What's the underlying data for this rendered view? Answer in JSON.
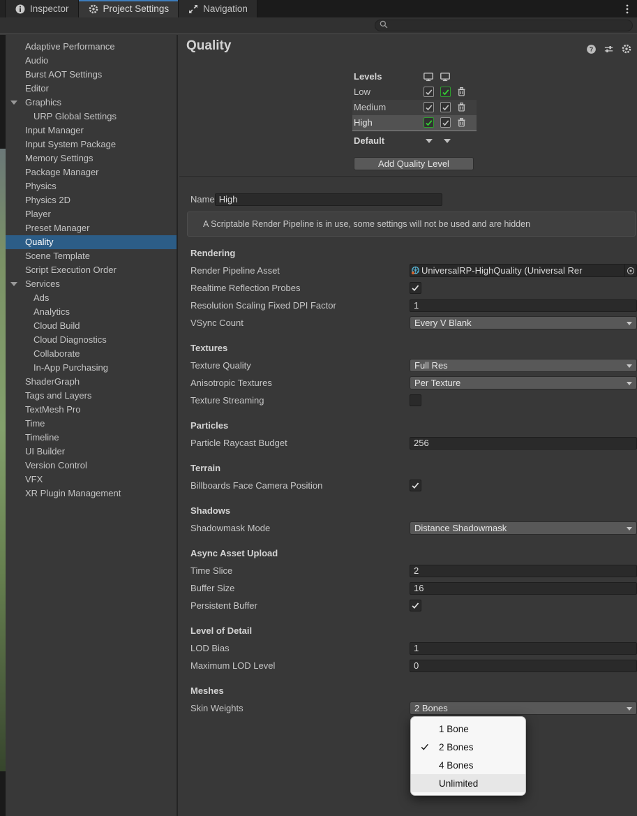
{
  "window": {
    "tabs": [
      {
        "label": "Inspector",
        "icon": "info-icon",
        "active": false
      },
      {
        "label": "Project Settings",
        "icon": "gear-icon",
        "active": true
      },
      {
        "label": "Navigation",
        "icon": "navigation-icon",
        "active": false
      }
    ],
    "search": {
      "value": ""
    }
  },
  "sidebar": {
    "items": [
      {
        "label": "Adaptive Performance",
        "indent": 0
      },
      {
        "label": "Audio",
        "indent": 0
      },
      {
        "label": "Burst AOT Settings",
        "indent": 0
      },
      {
        "label": "Editor",
        "indent": 0
      },
      {
        "label": "Graphics",
        "indent": 0,
        "expanded": true
      },
      {
        "label": "URP Global Settings",
        "indent": 1
      },
      {
        "label": "Input Manager",
        "indent": 0
      },
      {
        "label": "Input System Package",
        "indent": 0
      },
      {
        "label": "Memory Settings",
        "indent": 0
      },
      {
        "label": "Package Manager",
        "indent": 0
      },
      {
        "label": "Physics",
        "indent": 0
      },
      {
        "label": "Physics 2D",
        "indent": 0
      },
      {
        "label": "Player",
        "indent": 0
      },
      {
        "label": "Preset Manager",
        "indent": 0
      },
      {
        "label": "Quality",
        "indent": 0,
        "selected": true
      },
      {
        "label": "Scene Template",
        "indent": 0
      },
      {
        "label": "Script Execution Order",
        "indent": 0
      },
      {
        "label": "Services",
        "indent": 0,
        "expanded": true
      },
      {
        "label": "Ads",
        "indent": 1
      },
      {
        "label": "Analytics",
        "indent": 1
      },
      {
        "label": "Cloud Build",
        "indent": 1
      },
      {
        "label": "Cloud Diagnostics",
        "indent": 1
      },
      {
        "label": "Collaborate",
        "indent": 1
      },
      {
        "label": "In-App Purchasing",
        "indent": 1
      },
      {
        "label": "ShaderGraph",
        "indent": 0
      },
      {
        "label": "Tags and Layers",
        "indent": 0
      },
      {
        "label": "TextMesh Pro",
        "indent": 0
      },
      {
        "label": "Time",
        "indent": 0
      },
      {
        "label": "Timeline",
        "indent": 0
      },
      {
        "label": "UI Builder",
        "indent": 0
      },
      {
        "label": "Version Control",
        "indent": 0
      },
      {
        "label": "VFX",
        "indent": 0
      },
      {
        "label": "XR Plugin Management",
        "indent": 0
      }
    ]
  },
  "header": {
    "title": "Quality"
  },
  "quality_levels": {
    "label": "Levels",
    "platform_columns": 2,
    "rows": [
      {
        "name": "Low",
        "checks": [
          "gray",
          "green"
        ],
        "shade": "none"
      },
      {
        "name": "Medium",
        "checks": [
          "gray",
          "gray"
        ],
        "shade": "medium"
      },
      {
        "name": "High",
        "checks": [
          "green",
          "gray"
        ],
        "shade": "selected"
      }
    ],
    "default_label": "Default",
    "add_button": "Add Quality Level"
  },
  "name_row": {
    "label": "Name",
    "value": "High"
  },
  "warning": {
    "text": "A Scriptable Render Pipeline is in use, some settings will not be used and are hidden"
  },
  "sections": [
    {
      "title": "Rendering",
      "rows": [
        {
          "label": "Render Pipeline Asset",
          "type": "object",
          "value": "UniversalRP-HighQuality (Universal Rer"
        },
        {
          "label": "Realtime Reflection Probes",
          "type": "checkbox",
          "checked": true
        },
        {
          "label": "Resolution Scaling Fixed DPI Factor",
          "type": "text",
          "value": "1"
        },
        {
          "label": "VSync Count",
          "type": "dropdown",
          "value": "Every V Blank"
        }
      ]
    },
    {
      "title": "Textures",
      "rows": [
        {
          "label": "Texture Quality",
          "type": "dropdown",
          "value": "Full Res"
        },
        {
          "label": "Anisotropic Textures",
          "type": "dropdown",
          "value": "Per Texture"
        },
        {
          "label": "Texture Streaming",
          "type": "checkbox",
          "checked": false
        }
      ]
    },
    {
      "title": "Particles",
      "rows": [
        {
          "label": "Particle Raycast Budget",
          "type": "text",
          "value": "256"
        }
      ]
    },
    {
      "title": "Terrain",
      "rows": [
        {
          "label": "Billboards Face Camera Position",
          "type": "checkbox",
          "checked": true
        }
      ]
    },
    {
      "title": "Shadows",
      "rows": [
        {
          "label": "Shadowmask Mode",
          "type": "dropdown",
          "value": "Distance Shadowmask"
        }
      ]
    },
    {
      "title": "Async Asset Upload",
      "rows": [
        {
          "label": "Time Slice",
          "type": "text",
          "value": "2"
        },
        {
          "label": "Buffer Size",
          "type": "text",
          "value": "16"
        },
        {
          "label": "Persistent Buffer",
          "type": "checkbox",
          "checked": true
        }
      ]
    },
    {
      "title": "Level of Detail",
      "rows": [
        {
          "label": "LOD Bias",
          "type": "text",
          "value": "1"
        },
        {
          "label": "Maximum LOD Level",
          "type": "text",
          "value": "0"
        }
      ]
    },
    {
      "title": "Meshes",
      "rows": [
        {
          "label": "Skin Weights",
          "type": "dropdown",
          "value": "2 Bones"
        }
      ]
    }
  ],
  "skin_weights_menu": {
    "items": [
      {
        "label": "1 Bone",
        "checked": false,
        "highlighted": false
      },
      {
        "label": "2 Bones",
        "checked": true,
        "highlighted": false
      },
      {
        "label": "4 Bones",
        "checked": false,
        "highlighted": false
      },
      {
        "label": "Unlimited",
        "checked": false,
        "highlighted": true
      }
    ]
  },
  "colors": {
    "background": "#383838",
    "tab_accent": "#3D7DBD",
    "selection_blue": "#2C5D87",
    "green_check": "#35CC35",
    "field_bg": "#2A2A2A",
    "dropdown_bg": "#585858",
    "popup_bg": "#F7F7F7"
  }
}
